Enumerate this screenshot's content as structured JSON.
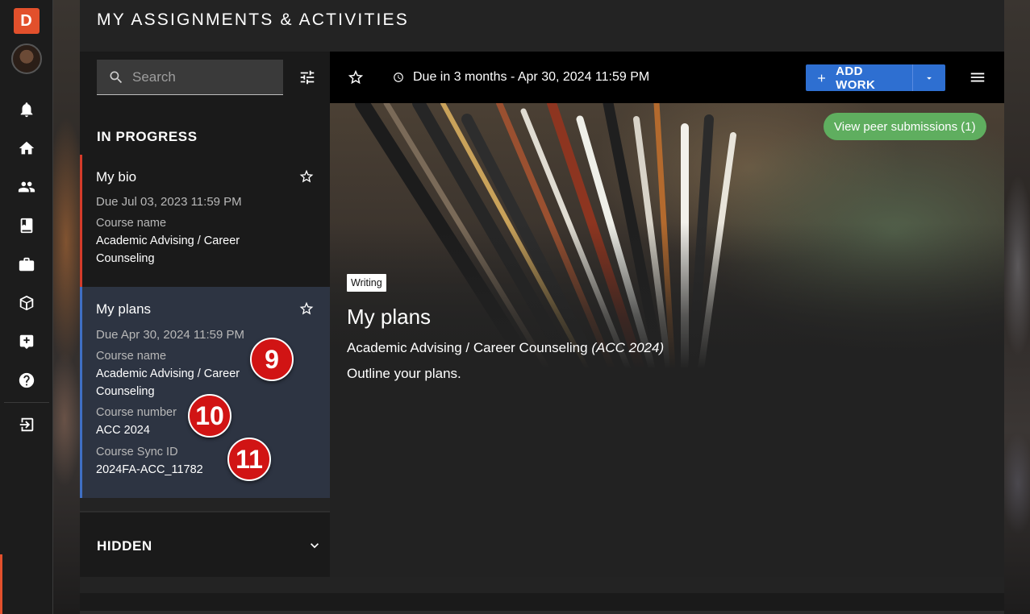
{
  "rail": {
    "logo_letter": "D",
    "icons": [
      "bell-icon",
      "home-icon",
      "people-icon",
      "book-icon",
      "briefcase-icon",
      "cube-icon",
      "add-box-icon",
      "help-icon",
      "logout-icon"
    ]
  },
  "page": {
    "title": "MY ASSIGNMENTS & ACTIVITIES"
  },
  "search": {
    "placeholder": "Search",
    "value": ""
  },
  "sections": {
    "in_progress": "IN PROGRESS",
    "hidden": "HIDDEN"
  },
  "assignments": [
    {
      "title": "My bio",
      "due": "Due Jul 03, 2023 11:59 PM",
      "course_name_label": "Course name",
      "course_name": "Academic Advising / Career Counseling",
      "accent_color": "#d43b2a"
    },
    {
      "title": "My plans",
      "due": "Due Apr 30, 2024 11:59 PM",
      "course_name_label": "Course name",
      "course_name": "Academic Advising / Career Counseling",
      "course_number_label": "Course number",
      "course_number": "ACC 2024",
      "sync_id_label": "Course Sync ID",
      "sync_id": "2024FA-ACC_11782",
      "accent_color": "#3f6fc4",
      "selected": true
    }
  ],
  "toolbar": {
    "due_text": "Due in 3 months - Apr 30, 2024 11:59 PM",
    "add_work_label": "ADD WORK"
  },
  "detail": {
    "peer_button": "View peer submissions (1)",
    "tag": "Writing",
    "title": "My plans",
    "course": "Academic Advising / Career Counseling",
    "course_code": "(ACC 2024)",
    "description": "Outline your plans."
  },
  "markers": [
    "9",
    "10",
    "11"
  ],
  "colors": {
    "brand": "#e2502c",
    "primary": "#2e6fd1",
    "success": "#5fae5f",
    "marker": "#d11414"
  }
}
